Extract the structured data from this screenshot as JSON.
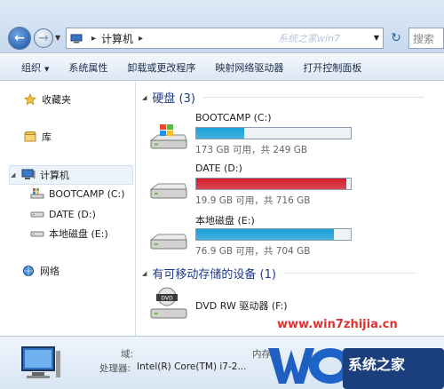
{
  "address": {
    "crumb": "计算机",
    "watermark": "系统之家win7",
    "search_placeholder": "搜索"
  },
  "toolbar": {
    "organize": "组织",
    "system_props": "系统属性",
    "uninstall": "卸载或更改程序",
    "map_drive": "映射网络驱动器",
    "control_panel": "打开控制面板"
  },
  "nav": {
    "favorites": "收藏夹",
    "library": "库",
    "computer": "计算机",
    "drives": [
      "BOOTCAMP (C:)",
      "DATE (D:)",
      "本地磁盘 (E:)"
    ],
    "network": "网络"
  },
  "groups": {
    "hard_disks": "硬盘 (3)",
    "removable": "有可移动存储的设备 (1)"
  },
  "drives": [
    {
      "name": "BOOTCAMP (C:)",
      "info": "173 GB 可用，共 249 GB",
      "used_fraction": 0.31,
      "color": "#1aa1d8"
    },
    {
      "name": "DATE (D:)",
      "info": "19.9 GB 可用，共 716 GB",
      "used_fraction": 0.97,
      "color": "#d41d2a"
    },
    {
      "name": "本地磁盘 (E:)",
      "info": "76.9 GB 可用，共 704 GB",
      "used_fraction": 0.89,
      "color": "#1aa1d8"
    }
  ],
  "removable": {
    "name": "DVD RW 驱动器 (F:)"
  },
  "details": {
    "domain_label": "域:",
    "memory_label": "内存",
    "processor_label": "处理器:",
    "processor_value": "Intel(R) Core(TM) i7-2..."
  },
  "watermark": {
    "url": "www.win7zhijia.cn",
    "brand": "系统之家"
  }
}
